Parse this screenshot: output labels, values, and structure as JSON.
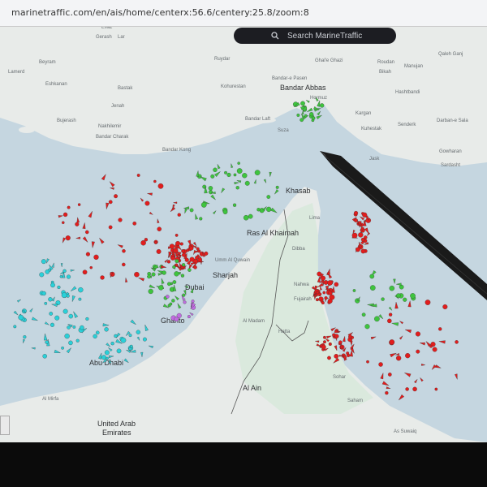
{
  "browser": {
    "url": "marinetraffic.com/en/ais/home/centerx:56.6/centery:25.8/zoom:8"
  },
  "search": {
    "placeholder": "Search MarineTraffic"
  },
  "map_labels": {
    "major": [
      {
        "text": "Bandar Abbas"
      },
      {
        "text": "Khasab"
      },
      {
        "text": "Ras Al Khaimah"
      },
      {
        "text": "Umm Al Quwain"
      },
      {
        "text": "Sharjah"
      },
      {
        "text": "Dubai"
      },
      {
        "text": "Ghanto"
      },
      {
        "text": "Abu Dhabi"
      },
      {
        "text": "Al Ain"
      },
      {
        "text": "Fujairah"
      },
      {
        "text": "Sohar"
      },
      {
        "text": "Nahwa"
      },
      {
        "text": "United Arab"
      },
      {
        "text": "Emirates"
      }
    ],
    "minor": [
      {
        "text": "Evaz"
      },
      {
        "text": "Gerash"
      },
      {
        "text": "Lar"
      },
      {
        "text": "Beyram"
      },
      {
        "text": "Lamerd"
      },
      {
        "text": "Eshkanan"
      },
      {
        "text": "Ruydar"
      },
      {
        "text": "Ghal'e Ghazi"
      },
      {
        "text": "Roudan"
      },
      {
        "text": "Manujan"
      },
      {
        "text": "Qaleh Ganj"
      },
      {
        "text": "Bikah"
      },
      {
        "text": "Kohurestan"
      },
      {
        "text": "Bastak"
      },
      {
        "text": "Hormuz"
      },
      {
        "text": "Hashtbandi"
      },
      {
        "text": "Jenah"
      },
      {
        "text": "Kargan"
      },
      {
        "text": "Bandar Laft"
      },
      {
        "text": "Suza"
      },
      {
        "text": "Kuhestak"
      },
      {
        "text": "Senderk"
      },
      {
        "text": "Darban-e Sala"
      },
      {
        "text": "Bujerash"
      },
      {
        "text": "Nakhilemir"
      },
      {
        "text": "Bandar Charak"
      },
      {
        "text": "Bandar Kong"
      },
      {
        "text": "Jask"
      },
      {
        "text": "Gowharan"
      },
      {
        "text": "Sardasht"
      },
      {
        "text": "Lima"
      },
      {
        "text": "Dibba"
      },
      {
        "text": "Al Madam"
      },
      {
        "text": "Hatta"
      },
      {
        "text": "Al Mirfa"
      },
      {
        "text": "Saham"
      },
      {
        "text": "As Suwaiq"
      },
      {
        "text": "Bandar-e Pasen"
      }
    ]
  },
  "vessel_summary": {
    "colors": {
      "tanker": "#e11d1d",
      "cargo": "#3ec43e",
      "passenger": "#2ad0d8",
      "pleasure": "#c06ce0"
    }
  },
  "ui": {
    "zoom_control": ""
  }
}
